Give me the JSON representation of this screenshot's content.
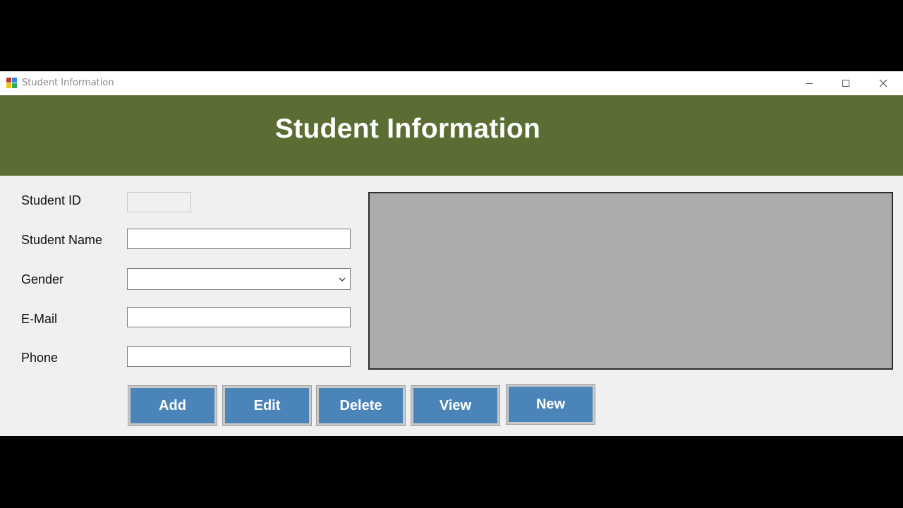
{
  "window": {
    "title": "Student Information",
    "controls": [
      "minimize",
      "maximize",
      "close"
    ]
  },
  "header": {
    "title": "Student Information",
    "background": "#5a6e33"
  },
  "form": {
    "student_id": {
      "label": "Student ID",
      "value": ""
    },
    "student_name": {
      "label": "Student Name",
      "value": ""
    },
    "gender": {
      "label": "Gender",
      "selected": ""
    },
    "email": {
      "label": "E-Mail",
      "value": ""
    },
    "phone": {
      "label": "Phone",
      "value": ""
    }
  },
  "buttons": {
    "add": "Add",
    "edit": "Edit",
    "delete": "Delete",
    "view": "View",
    "new": "New",
    "color": "#4b84b8"
  },
  "grid": {
    "background": "#ababab"
  }
}
